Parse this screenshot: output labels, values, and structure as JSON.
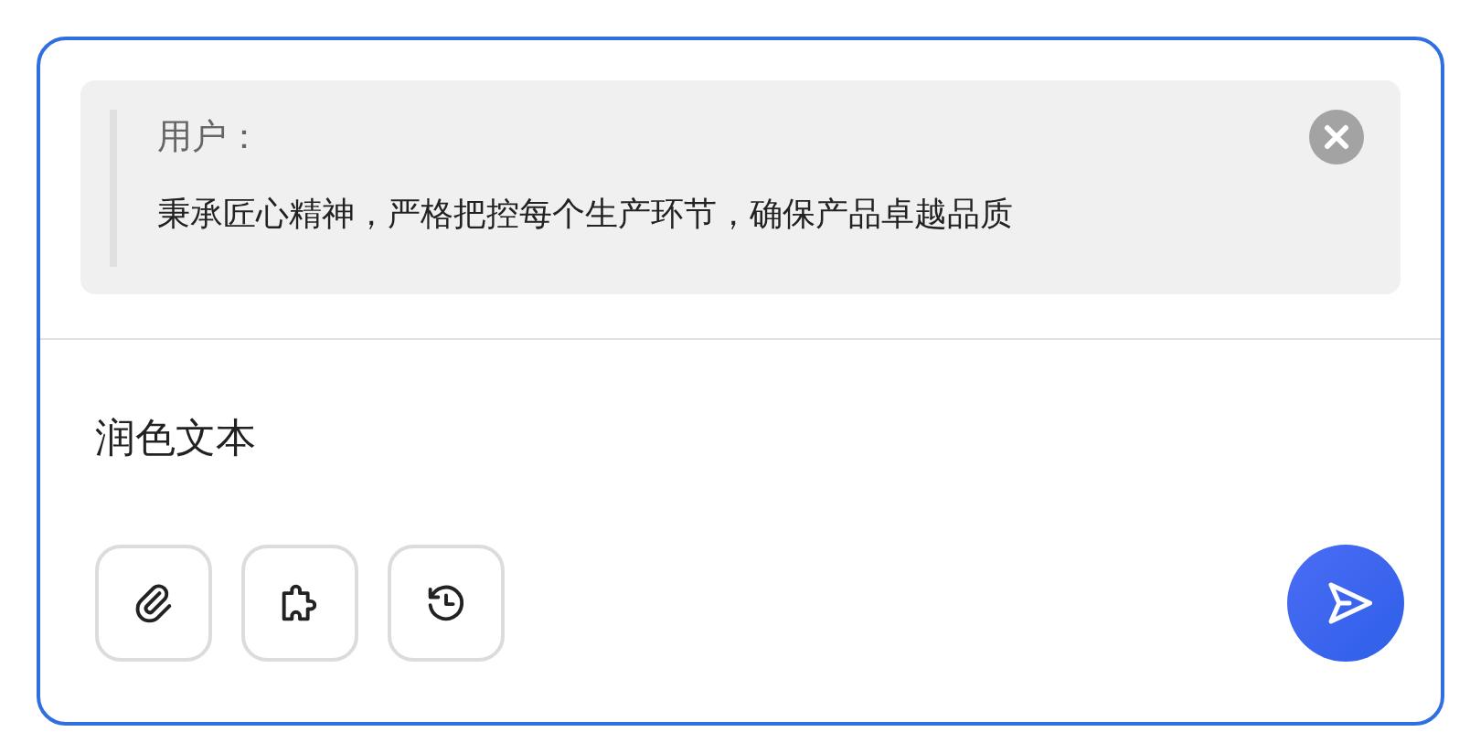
{
  "quote": {
    "label": "用户：",
    "text": "秉承匠心精神，严格把控每个生产环节，确保产品卓越品质"
  },
  "input": {
    "value": "润色文本"
  },
  "tools": [
    {
      "kind": "attach"
    },
    {
      "kind": "plugin"
    },
    {
      "kind": "history"
    }
  ]
}
